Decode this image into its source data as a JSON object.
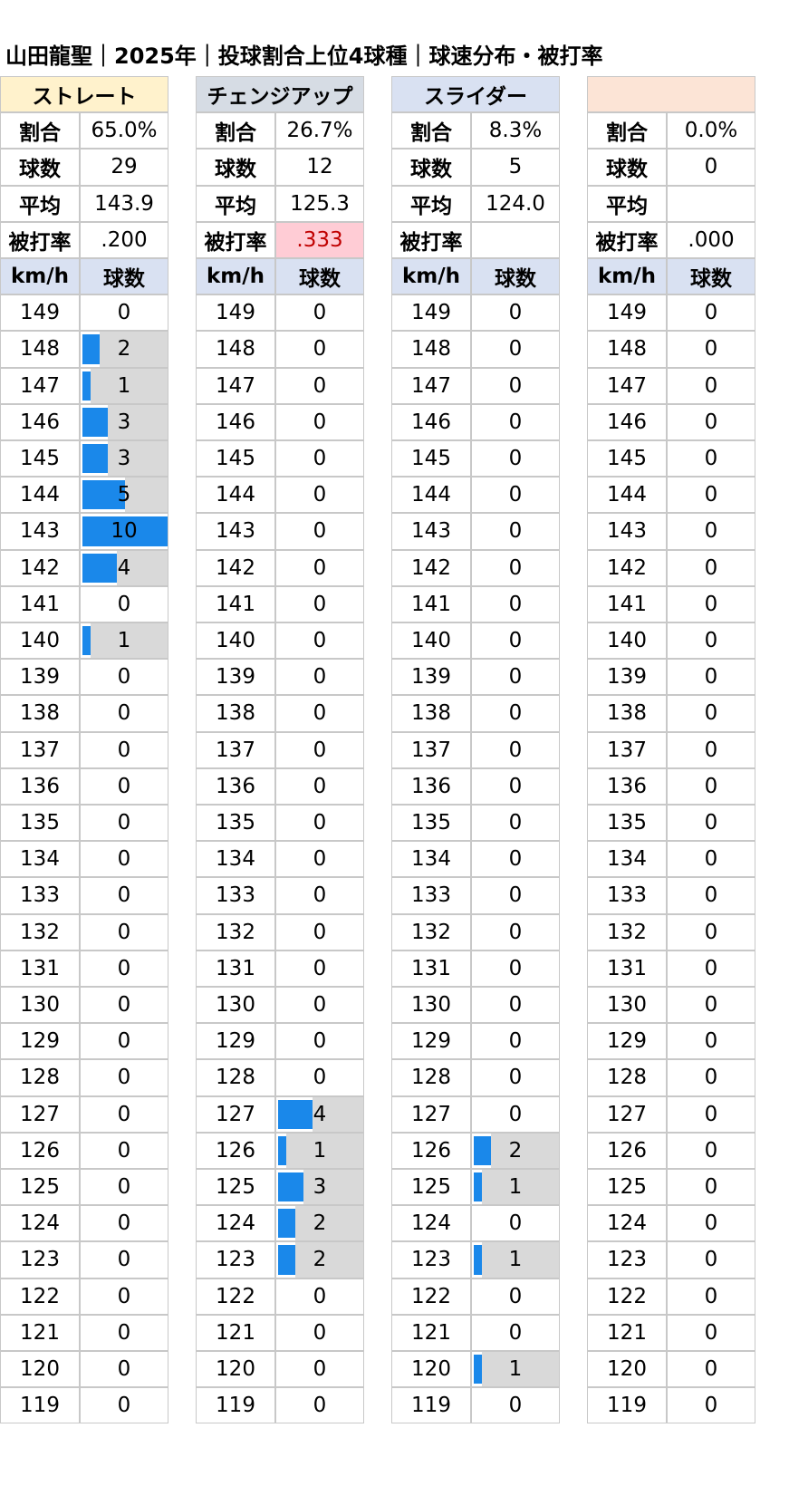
{
  "title": "山田龍聖｜2025年｜投球割合上位4球種｜球速分布・被打率",
  "labels": {
    "ratio": "割合",
    "count": "球数",
    "avg": "平均",
    "babip": "被打率",
    "kmh": "km/h",
    "pitches": "球数"
  },
  "colors": {
    "bar": "#1a88ea",
    "bar_bg": "#d9d9d9",
    "header_row": "#d9e1f2",
    "highlight_bad": "#ffccd5",
    "bad_text": "#c00000"
  },
  "chart_data": {
    "type": "table",
    "title": "山田龍聖｜2025年｜投球割合上位4球種｜球速分布・被打率",
    "speeds": [
      "149",
      "148",
      "147",
      "146",
      "145",
      "144",
      "143",
      "142",
      "141",
      "140",
      "139",
      "138",
      "137",
      "136",
      "135",
      "134",
      "133",
      "132",
      "131",
      "130",
      "129",
      "128",
      "127",
      "126",
      "125",
      "124",
      "123",
      "122",
      "121",
      "120",
      "119"
    ],
    "max_count": 10,
    "pitches": [
      {
        "name": "ストレート",
        "name_bg": "#fff2cc",
        "ratio": "65.0%",
        "count": "29",
        "avg": "143.9",
        "babip": ".200",
        "babip_highlight": false,
        "counts": [
          0,
          2,
          1,
          3,
          3,
          5,
          10,
          4,
          0,
          1,
          0,
          0,
          0,
          0,
          0,
          0,
          0,
          0,
          0,
          0,
          0,
          0,
          0,
          0,
          0,
          0,
          0,
          0,
          0,
          0,
          0
        ]
      },
      {
        "name": "チェンジアップ",
        "name_bg": "#d6dce4",
        "ratio": "26.7%",
        "count": "12",
        "avg": "125.3",
        "babip": ".333",
        "babip_highlight": true,
        "counts": [
          0,
          0,
          0,
          0,
          0,
          0,
          0,
          0,
          0,
          0,
          0,
          0,
          0,
          0,
          0,
          0,
          0,
          0,
          0,
          0,
          0,
          0,
          4,
          1,
          3,
          2,
          2,
          0,
          0,
          0,
          0
        ]
      },
      {
        "name": "スライダー",
        "name_bg": "#d9e1f2",
        "ratio": "8.3%",
        "count": "5",
        "avg": "124.0",
        "babip": "",
        "babip_highlight": false,
        "counts": [
          0,
          0,
          0,
          0,
          0,
          0,
          0,
          0,
          0,
          0,
          0,
          0,
          0,
          0,
          0,
          0,
          0,
          0,
          0,
          0,
          0,
          0,
          0,
          2,
          1,
          0,
          1,
          0,
          0,
          1,
          0
        ]
      },
      {
        "name": "",
        "name_bg": "#fce4d6",
        "ratio": "0.0%",
        "count": "0",
        "avg": "",
        "babip": ".000",
        "babip_highlight": false,
        "counts": [
          0,
          0,
          0,
          0,
          0,
          0,
          0,
          0,
          0,
          0,
          0,
          0,
          0,
          0,
          0,
          0,
          0,
          0,
          0,
          0,
          0,
          0,
          0,
          0,
          0,
          0,
          0,
          0,
          0,
          0,
          0
        ]
      }
    ]
  }
}
